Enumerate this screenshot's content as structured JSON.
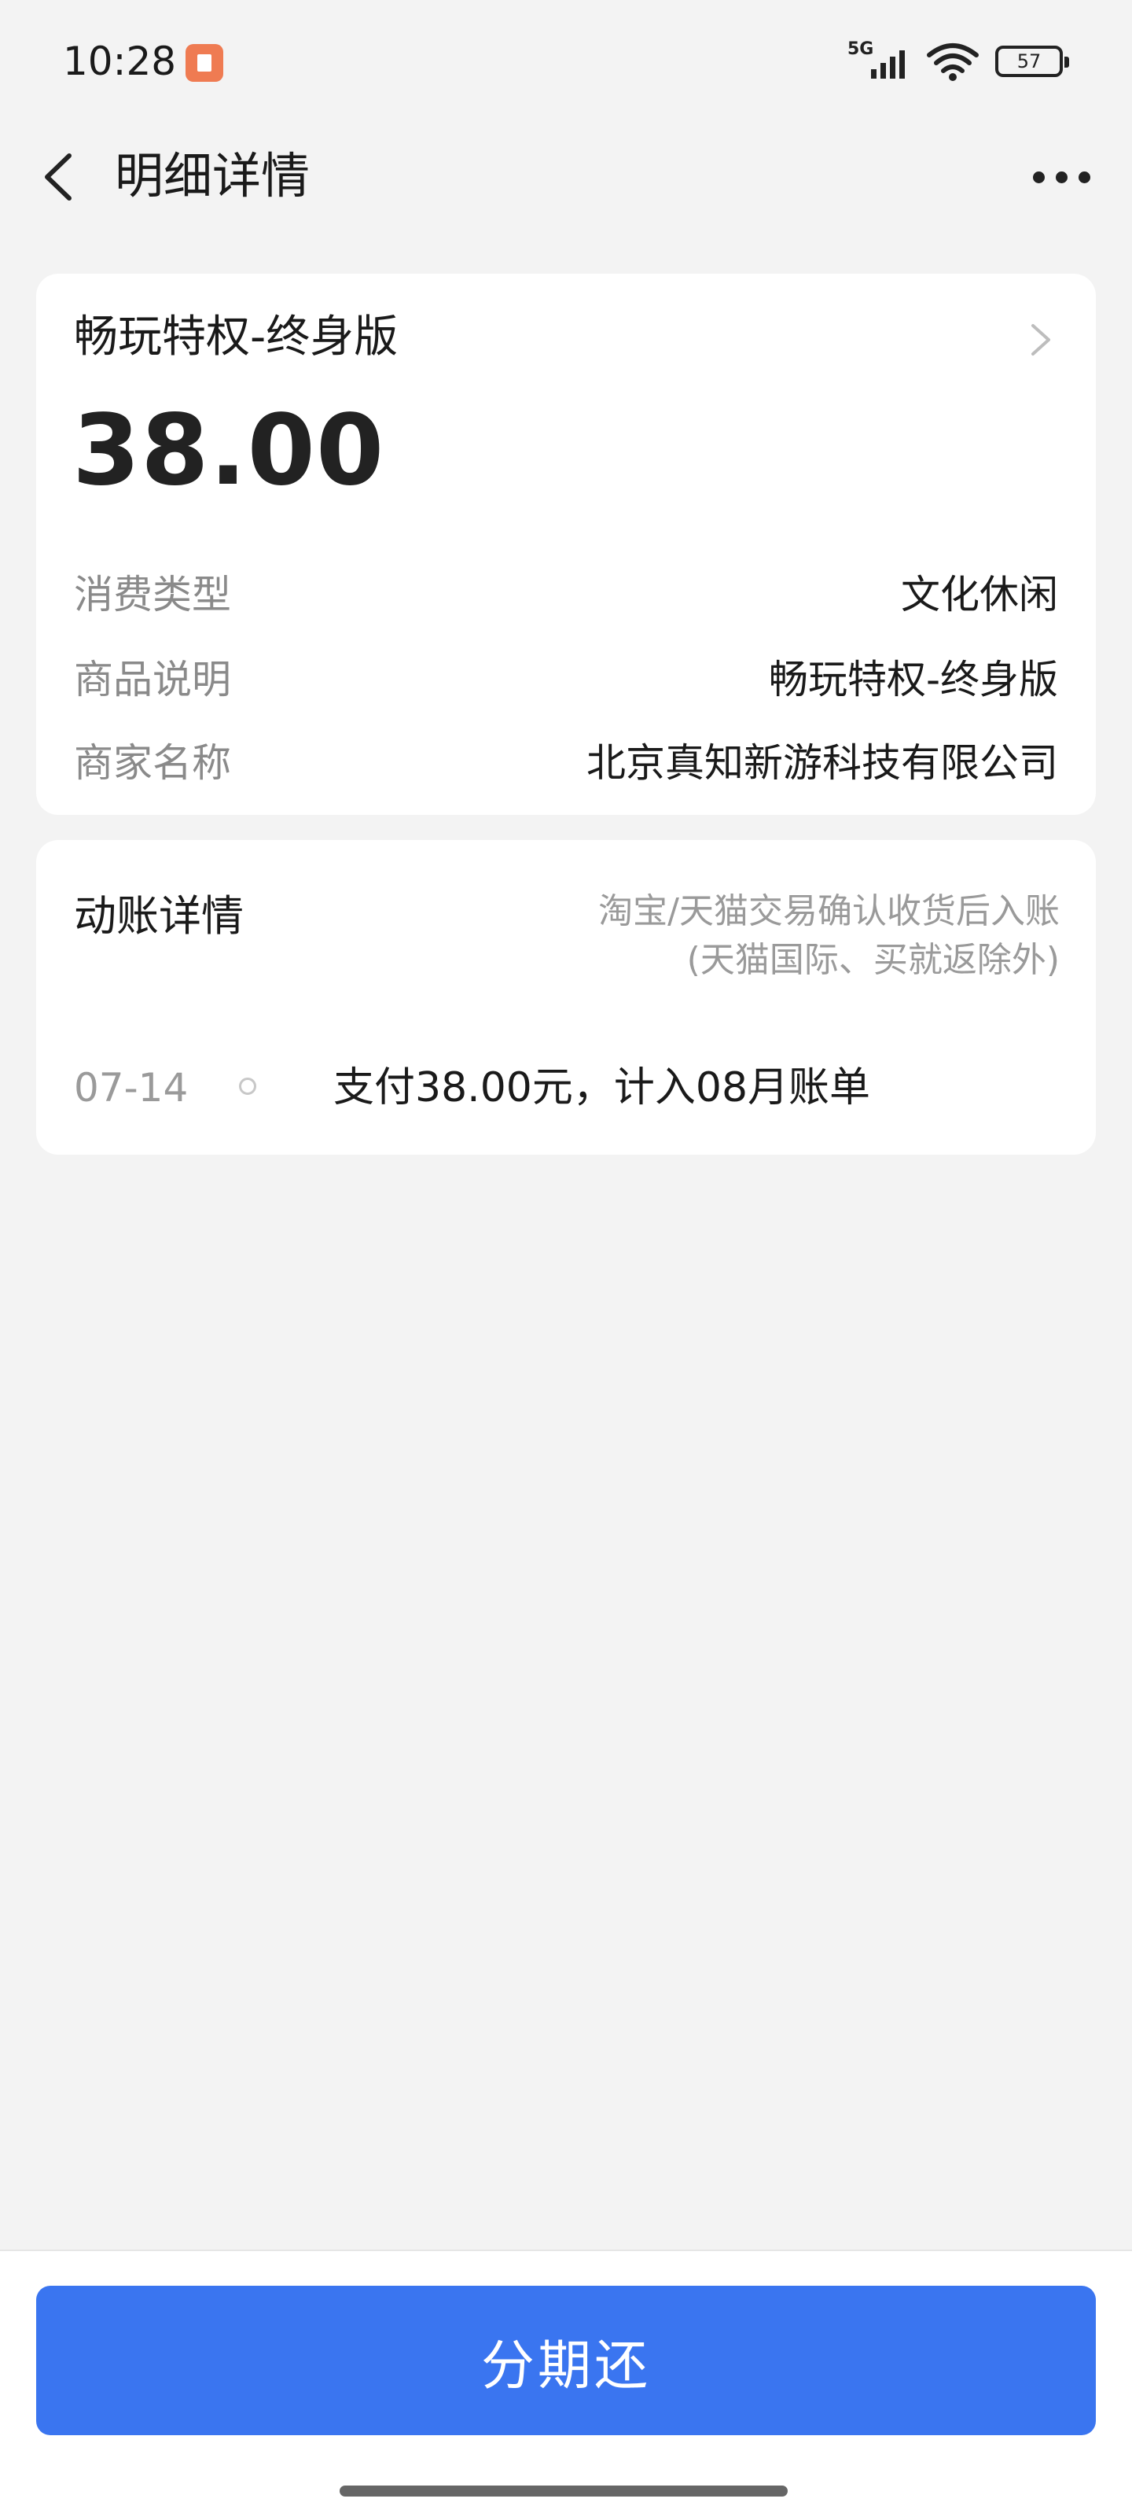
{
  "status_bar": {
    "time": "10:28",
    "network": "5G",
    "battery": "57"
  },
  "nav": {
    "title": "明细详情"
  },
  "transaction": {
    "title": "畅玩特权-终身版",
    "amount": "38.00",
    "details": [
      {
        "label": "消费类型",
        "value": "文化休闲"
      },
      {
        "label": "商品说明",
        "value": "畅玩特权-终身版"
      },
      {
        "label": "商家名称",
        "value": "北京真知新游科技有限公司"
      }
    ]
  },
  "movement": {
    "title": "动账详情",
    "note_line1": "淘宝/天猫交易确认收货后入账",
    "note_line2": "(天猫国际、买就返除外)",
    "timeline": [
      {
        "date": "07-14",
        "text": "支付38.00元，计入08月账单"
      }
    ]
  },
  "action": {
    "button_label": "分期还",
    "button_color": "#3a75f0"
  }
}
